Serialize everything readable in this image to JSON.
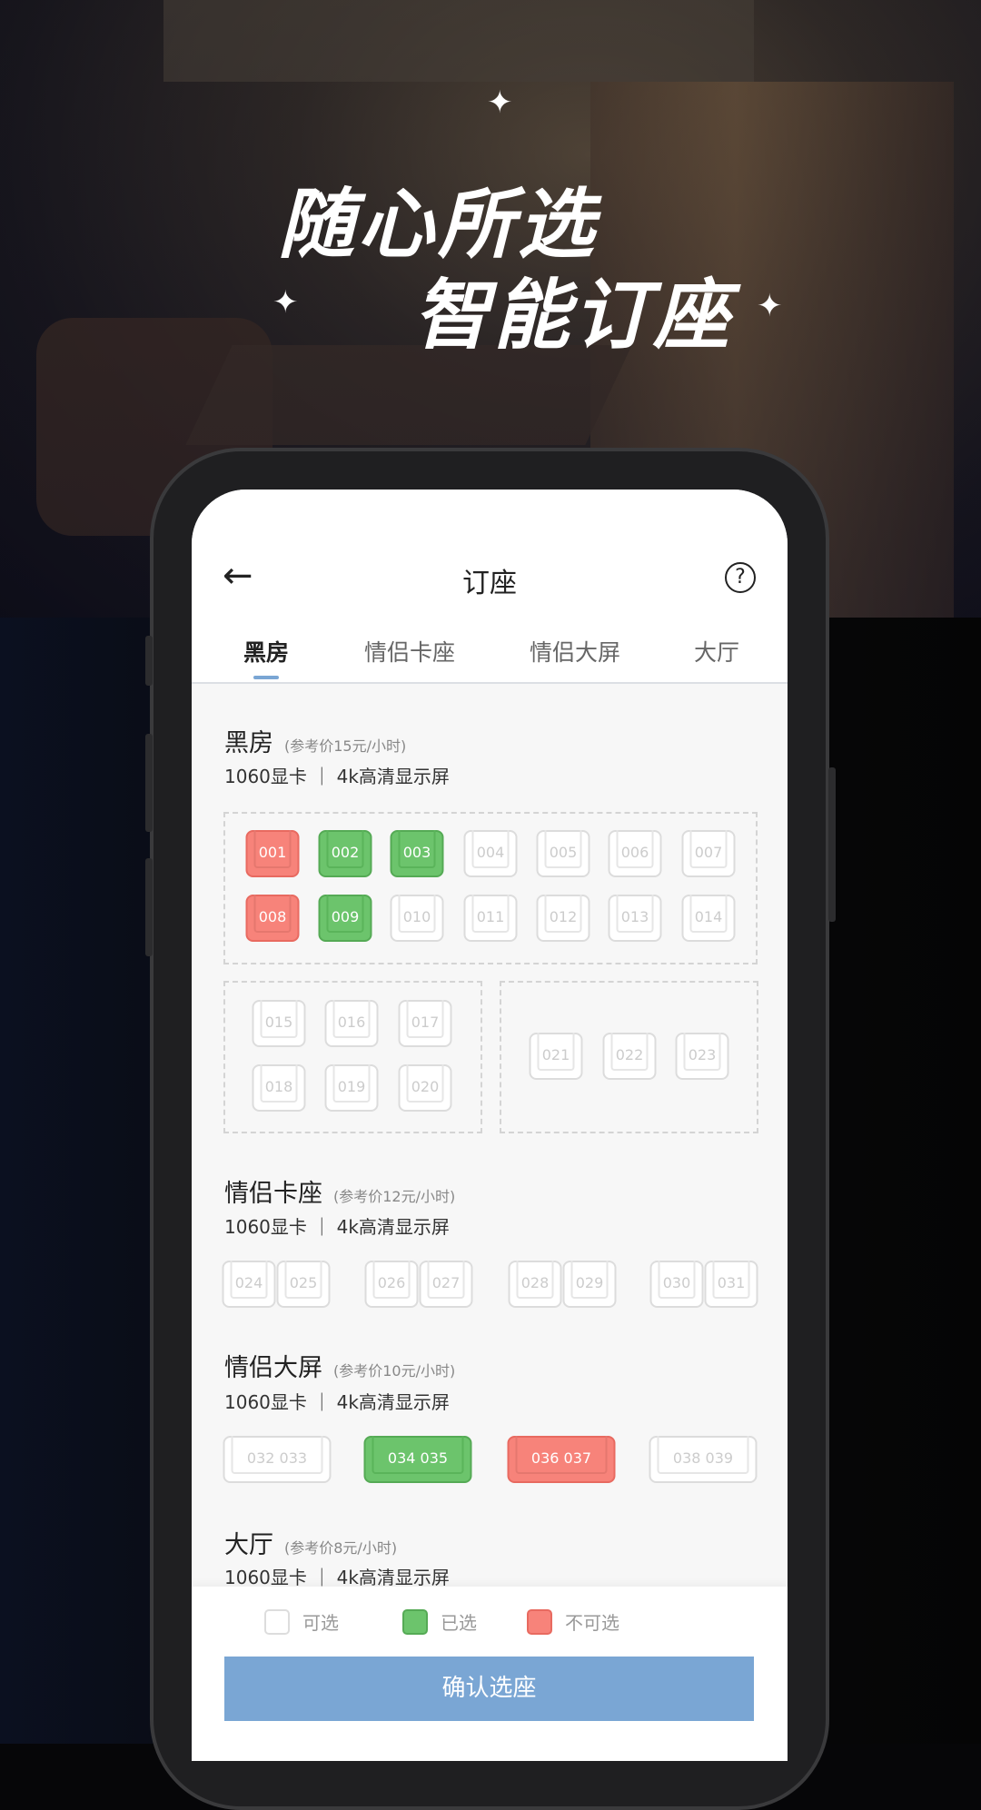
{
  "promo": {
    "line1": "随心所选",
    "line2": "智能订座"
  },
  "header": {
    "title": "订座",
    "back_icon": "arrow-left-icon",
    "help_icon": "question-circle-icon"
  },
  "tabs": [
    {
      "label": "黑房",
      "active": true
    },
    {
      "label": "情侣卡座",
      "active": false
    },
    {
      "label": "情侣大屏",
      "active": false
    },
    {
      "label": "大厅",
      "active": false
    }
  ],
  "sections": [
    {
      "title": "黑房",
      "price": "(参考价15元/小时)",
      "spec": "1060显卡 ｜ 4k高清显示屏"
    },
    {
      "title": "情侣卡座",
      "price": "(参考价12元/小时)",
      "spec": "1060显卡 ｜ 4k高清显示屏"
    },
    {
      "title": "情侣大屏",
      "price": "(参考价10元/小时)",
      "spec": "1060显卡 ｜ 4k高清显示屏"
    },
    {
      "title": "大厅",
      "price": "(参考价8元/小时)",
      "spec": "1060显卡 ｜ 4k高清显示屏"
    }
  ],
  "seats_blackroom": [
    {
      "n": "001",
      "s": "unavailable"
    },
    {
      "n": "002",
      "s": "selected"
    },
    {
      "n": "003",
      "s": "selected"
    },
    {
      "n": "004",
      "s": "available"
    },
    {
      "n": "005",
      "s": "available"
    },
    {
      "n": "006",
      "s": "available"
    },
    {
      "n": "007",
      "s": "available"
    },
    {
      "n": "008",
      "s": "unavailable"
    },
    {
      "n": "009",
      "s": "selected"
    },
    {
      "n": "010",
      "s": "available"
    },
    {
      "n": "011",
      "s": "available"
    },
    {
      "n": "012",
      "s": "available"
    },
    {
      "n": "013",
      "s": "available"
    },
    {
      "n": "014",
      "s": "available"
    },
    {
      "n": "015",
      "s": "available"
    },
    {
      "n": "016",
      "s": "available"
    },
    {
      "n": "017",
      "s": "available"
    },
    {
      "n": "018",
      "s": "available"
    },
    {
      "n": "019",
      "s": "available"
    },
    {
      "n": "020",
      "s": "available"
    },
    {
      "n": "021",
      "s": "available"
    },
    {
      "n": "022",
      "s": "available"
    },
    {
      "n": "023",
      "s": "available"
    }
  ],
  "seats_couple_booth": [
    {
      "n": "024",
      "s": "available"
    },
    {
      "n": "025",
      "s": "available"
    },
    {
      "n": "026",
      "s": "available"
    },
    {
      "n": "027",
      "s": "available"
    },
    {
      "n": "028",
      "s": "available"
    },
    {
      "n": "029",
      "s": "available"
    },
    {
      "n": "030",
      "s": "available"
    },
    {
      "n": "031",
      "s": "available"
    }
  ],
  "seats_couple_screen": [
    {
      "n": "032   033",
      "s": "available"
    },
    {
      "n": "034   035",
      "s": "selected"
    },
    {
      "n": "036   037",
      "s": "unavailable"
    },
    {
      "n": "038   039",
      "s": "available"
    }
  ],
  "legend": [
    {
      "label": "可选",
      "s": "available"
    },
    {
      "label": "已选",
      "s": "selected"
    },
    {
      "label": "不可选",
      "s": "unavailable"
    }
  ],
  "colors": {
    "selected": "#6cc46c",
    "unavailable": "#f7837a",
    "accent": "#7aa6d4"
  },
  "confirm_label": "确认选座"
}
